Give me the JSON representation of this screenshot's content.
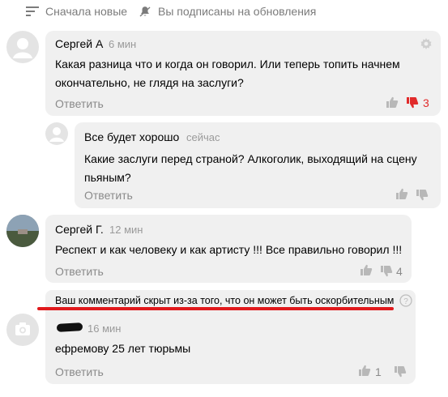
{
  "toolbar": {
    "sort_label": "Сначала новые",
    "subscribe_label": "Вы подписаны на обновления"
  },
  "comments": [
    {
      "author": "Сергей А",
      "time": "6 мин",
      "text_line1": "Какая  разница что и когда он говорил. Или теперь топить начнем",
      "text_line2": "окончательно, не глядя на заслуги?",
      "reply": "Ответить",
      "dislikes": "3"
    },
    {
      "author": "Все будет хорошо",
      "time": "сейчас",
      "text_line1": "Какие заслуги перед страной? Алкоголик, выходящий на сцену",
      "text_line2": "пьяным?",
      "reply": "Ответить"
    },
    {
      "author": "Сергей Г.",
      "time": "12 мин",
      "text_line1": "Респект и как человеку и как артисту !!! Все правильно говорил !!!",
      "reply": "Ответить",
      "dislikes": "4"
    },
    {
      "hidden_notice": "Ваш комментарий скрыт из-за того, что он может быть оскорбительным",
      "time": "16 мин",
      "text_line1": "ефремову 25 лет тюрьмы",
      "reply": "Ответить",
      "likes": "1"
    }
  ],
  "colors": {
    "bubble": "#f0f0f0",
    "meta_gray": "#8a8a8a",
    "dislike_red": "#e12b2b",
    "underline_red": "#e0191c"
  }
}
